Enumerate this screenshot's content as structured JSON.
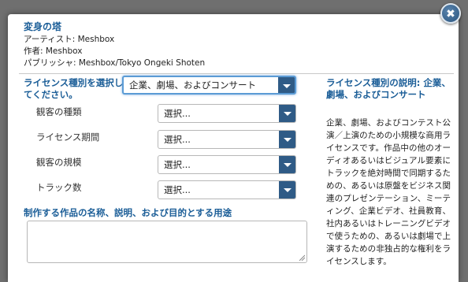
{
  "dialog": {
    "close_glyph": "✖",
    "title": "変身の塔",
    "artist": "アーティスト: Meshbox",
    "author": "作者: Meshbox",
    "publisher": "パブリッシャ: Meshbox/Tokyo Ongeki Shoten"
  },
  "form": {
    "license_label": "ライセンス種別を選択してください。",
    "license_selected": "企業、劇場、およびコンサート",
    "fields": [
      {
        "label": "観客の種類",
        "value": "選択..."
      },
      {
        "label": "ライセンス期間",
        "value": "選択..."
      },
      {
        "label": "観客の規模",
        "value": "選択..."
      },
      {
        "label": "トラック数",
        "value": "選択..."
      }
    ],
    "usage_label": "制作する作品の名称、説明、および目的とする用途",
    "usage_value": ""
  },
  "description": {
    "title": "ライセンス種別の説明: 企業、劇場、およびコンサート",
    "body": "企業、劇場、およびコンテスト公演／上演のための小規模な商用ライセンスです。作品中の他のオーディオあるいはビジュアル要素にトラックを絶対時間で同期するための、あるいは原盤をビジネス関連のプレゼンテーション、ミーティング、企業ビデオ、社員教育、社内あるいはトレーニングビデオで使うための、あるいは劇場で上演するための非独占的な権利をライセンスします。"
  },
  "colors": {
    "accent": "#1a5d97",
    "dropdown_button": "#2f5b86",
    "overlay": "#6f6f6f",
    "focus_ring": "#5b9bd5"
  },
  "icons": {
    "close": "close-icon",
    "dropdown": "chevron-down-icon"
  }
}
